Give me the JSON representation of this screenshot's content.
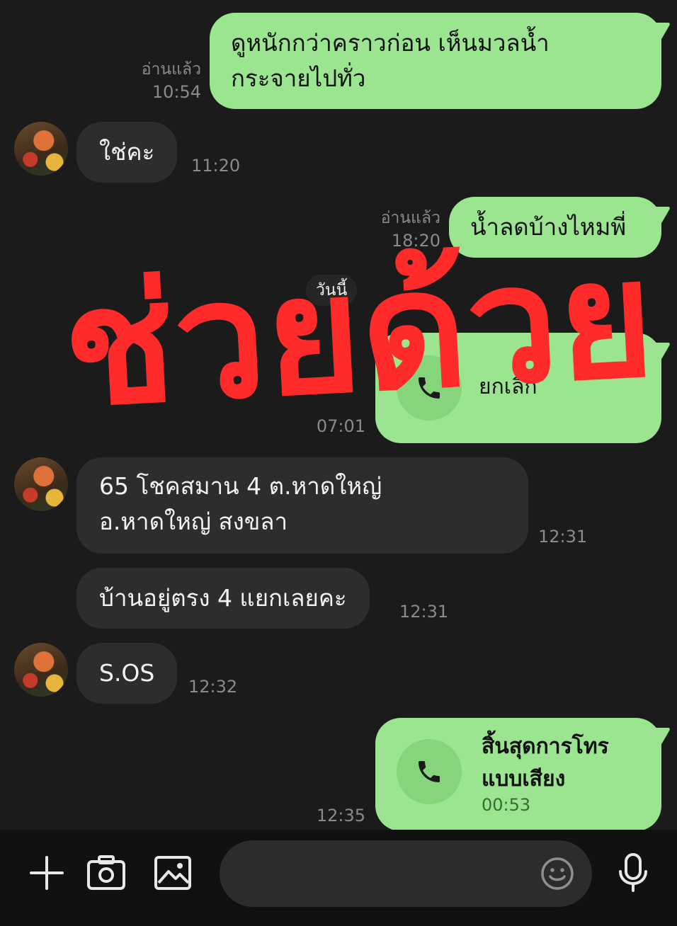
{
  "messages": {
    "m1": {
      "text_line1": "ดูหนักกว่าคราวก่อน เห็นมวลน้ำ",
      "text_line2": "กระจายไปทั่ว",
      "read": "อ่านแล้ว",
      "time": "10:54"
    },
    "m2": {
      "text": "ใช่คะ",
      "time": "11:20"
    },
    "m3": {
      "text": "น้ำลดบ้างไหมพี่",
      "read": "อ่านแล้ว",
      "time": "18:20"
    },
    "date_separator": "วันนี้",
    "m4": {
      "call_text": "ยกเลิก",
      "time": "07:01"
    },
    "m5": {
      "text_line1": "65 โชคสมาน 4 ต.หาดใหญ่",
      "text_line2": "อ.หาดใหญ่ สงขลา",
      "time": "12:31"
    },
    "m6": {
      "text": "บ้านอยู่ตรง 4 แยกเลยคะ",
      "time": "12:31"
    },
    "m7": {
      "text": "S.OS",
      "time": "12:32"
    },
    "m8": {
      "call_line1": "สิ้นสุดการโทร",
      "call_line2": "แบบเสียง",
      "duration": "00:53",
      "time": "12:35"
    }
  },
  "overlay": {
    "text": "ช่วยด้วย",
    "color": "#ff2a2a"
  },
  "colors": {
    "outgoing_bubble": "#9be591",
    "incoming_bubble": "#2d2d2d",
    "background": "#1b1b1b"
  },
  "input_bar": {
    "icons": [
      "plus-icon",
      "camera-icon",
      "image-icon",
      "emoji-icon",
      "microphone-icon"
    ],
    "placeholder": ""
  }
}
